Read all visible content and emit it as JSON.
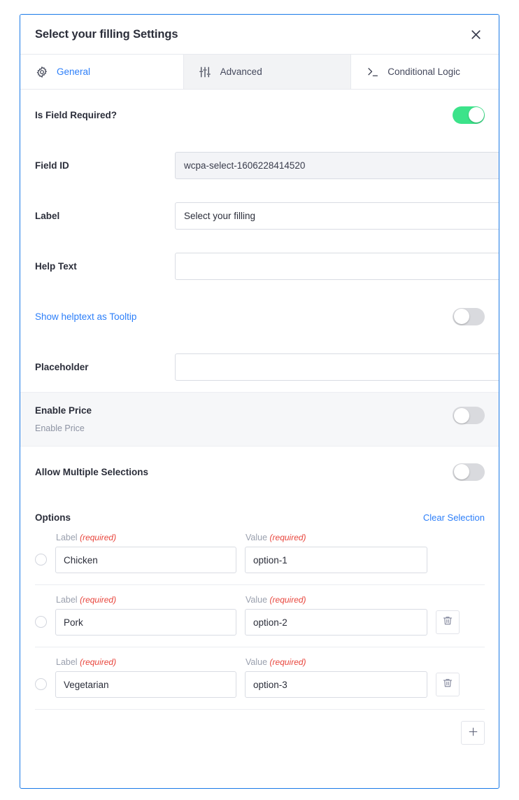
{
  "dialog": {
    "title": "Select your filling Settings",
    "close_icon": "close-icon",
    "accent_color": "#1a7ae8"
  },
  "tabs": [
    {
      "label": "General",
      "icon": "gear-icon",
      "active": true
    },
    {
      "label": "Advanced",
      "icon": "sliders-icon",
      "active": false
    },
    {
      "label": "Conditional Logic",
      "icon": "terminal-prompt-icon",
      "active": false
    }
  ],
  "general": {
    "required": {
      "label": "Is Field Required?",
      "state": "on"
    },
    "field_id": {
      "label": "Field ID",
      "value": "wcpa-select-1606228414520",
      "disabled": true
    },
    "field_label": {
      "label": "Label",
      "value": "Select your filling",
      "placeholder": ""
    },
    "help_text": {
      "label": "Help Text",
      "value": "",
      "placeholder": ""
    },
    "tooltip": {
      "label": "Show helptext as Tooltip",
      "state": "off"
    },
    "placeholder_field": {
      "label": "Placeholder",
      "value": "",
      "placeholder": ""
    },
    "enable_price": {
      "label": "Enable Price",
      "description": "Enable Price",
      "state": "off"
    },
    "allow_multiple": {
      "label": "Allow Multiple Selections",
      "state": "off"
    }
  },
  "options_section": {
    "title": "Options",
    "clear_label": "Clear Selection",
    "label_caption": "Label",
    "value_caption": "Value",
    "required_note": "(required)",
    "add_icon": "plus-icon",
    "delete_icon": "trash-icon",
    "rows": [
      {
        "label": "Chicken",
        "value": "option-1",
        "selected": false,
        "deletable": false
      },
      {
        "label": "Pork",
        "value": "option-2",
        "selected": false,
        "deletable": true
      },
      {
        "label": "Vegetarian",
        "value": "option-3",
        "selected": false,
        "deletable": true
      }
    ]
  },
  "colors": {
    "toggle_on": "#3ce38a",
    "toggle_off": "#d9dade",
    "link": "#2d7ff9",
    "required_red": "#e8453c"
  }
}
